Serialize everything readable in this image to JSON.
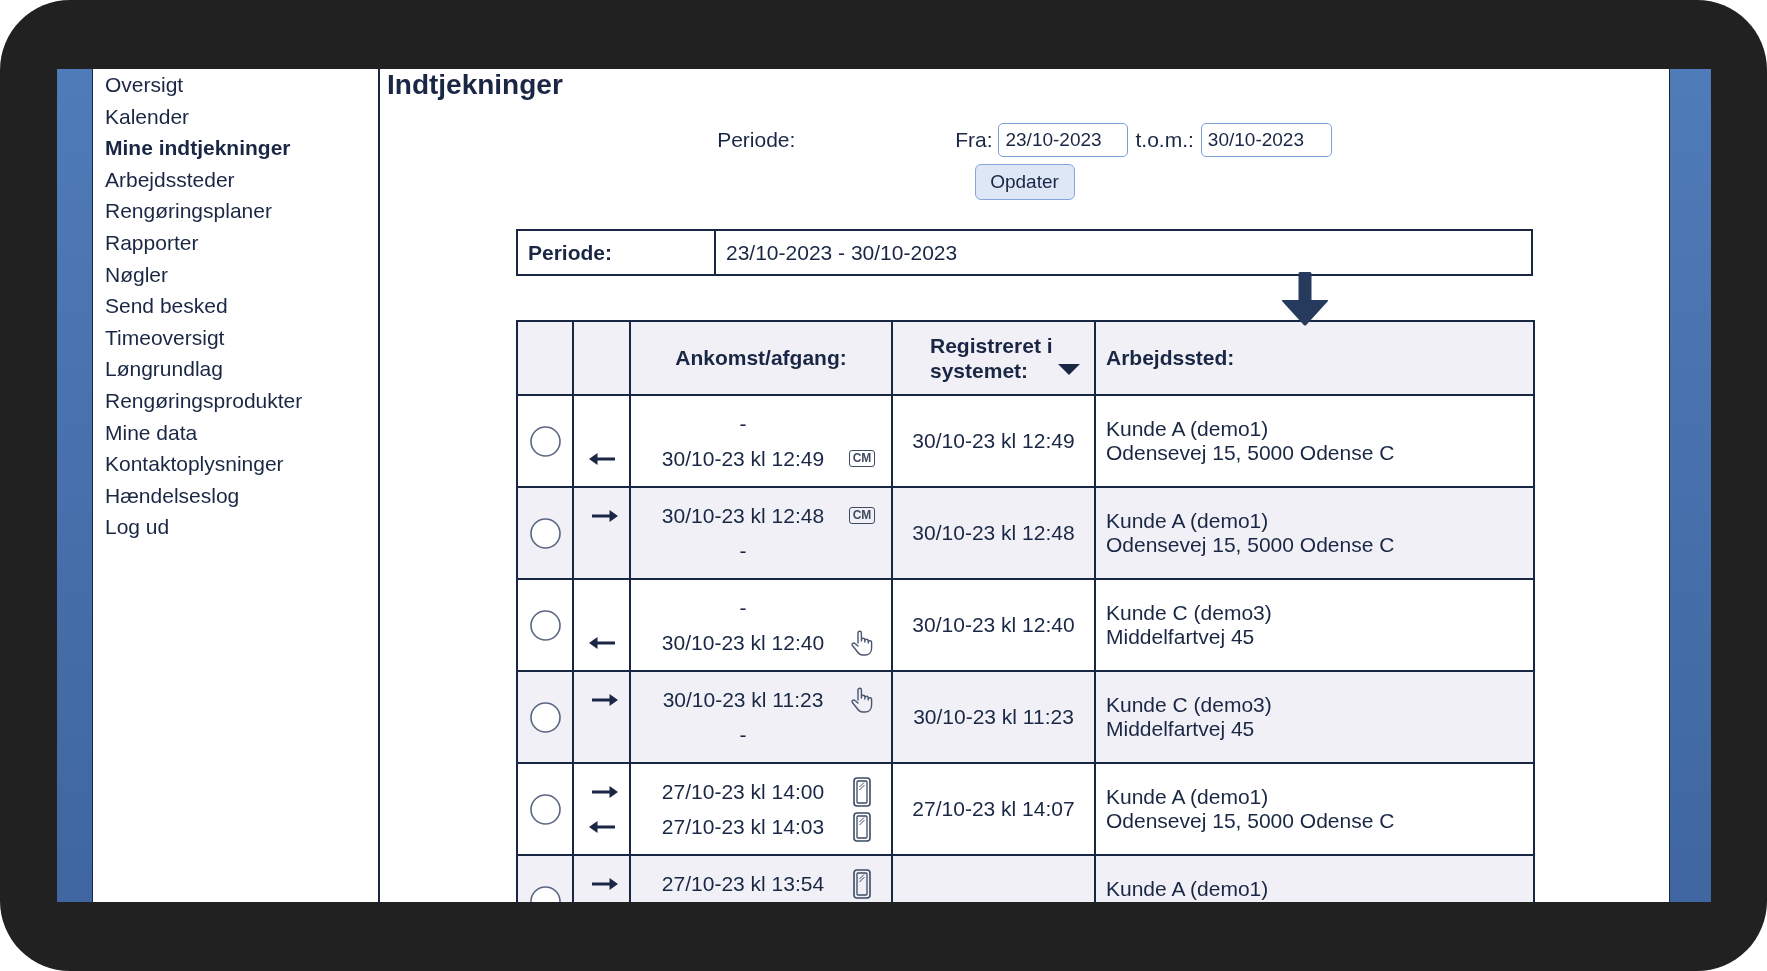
{
  "sidebar": {
    "items": [
      {
        "label": "Oversigt",
        "selected": false
      },
      {
        "label": "Kalender",
        "selected": false
      },
      {
        "label": "Mine indtjekninger",
        "selected": true
      },
      {
        "label": "Arbejdssteder",
        "selected": false
      },
      {
        "label": "Rengøringsplaner",
        "selected": false
      },
      {
        "label": "Rapporter",
        "selected": false
      },
      {
        "label": "Nøgler",
        "selected": false
      },
      {
        "label": "Send besked",
        "selected": false
      },
      {
        "label": "Timeoversigt",
        "selected": false
      },
      {
        "label": "Løngrundlag",
        "selected": false
      },
      {
        "label": "Rengøringsprodukter",
        "selected": false
      },
      {
        "label": "Mine data",
        "selected": false
      },
      {
        "label": "Kontaktoplysninger",
        "selected": false
      },
      {
        "label": "Hændelseslog",
        "selected": false
      },
      {
        "label": "Log ud",
        "selected": false
      }
    ]
  },
  "page": {
    "title": "Indtjekninger"
  },
  "filter": {
    "label": "Periode:",
    "from": {
      "label": "Fra:",
      "value": "23/10-2023"
    },
    "to": {
      "label": "t.o.m.:",
      "value": "30/10-2023"
    },
    "button": "Opdater"
  },
  "period_summary": {
    "label": "Periode:",
    "value": "23/10-2023 - 30/10-2023"
  },
  "table": {
    "columns": [
      {
        "label": "Ankomst/afgang:",
        "sorted": false
      },
      {
        "label": "Registreret i systemet:",
        "sorted": true
      },
      {
        "label": "Arbejdssted:",
        "sorted": false
      }
    ],
    "rows": [
      {
        "selected": false,
        "events": [
          {
            "kind": "missing",
            "time": "-"
          },
          {
            "kind": "departure",
            "time": "30/10-23 kl 12:49",
            "source": {
              "kind": "tag",
              "text": "CM"
            }
          }
        ],
        "registered": "30/10-23 kl 12:49",
        "workplace": {
          "name": "Kunde A (demo1)",
          "address": "Odensevej 15, 5000 Odense C"
        }
      },
      {
        "selected": false,
        "events": [
          {
            "kind": "arrival",
            "time": "30/10-23 kl 12:48",
            "source": {
              "kind": "tag",
              "text": "CM"
            }
          },
          {
            "kind": "missing",
            "time": "-"
          }
        ],
        "registered": "30/10-23 kl 12:48",
        "workplace": {
          "name": "Kunde A (demo1)",
          "address": "Odensevej 15, 5000 Odense C"
        }
      },
      {
        "selected": false,
        "events": [
          {
            "kind": "missing",
            "time": "-"
          },
          {
            "kind": "departure",
            "time": "30/10-23 kl 12:40",
            "source": {
              "kind": "hand"
            }
          }
        ],
        "registered": "30/10-23 kl 12:40",
        "workplace": {
          "name": "Kunde C (demo3)",
          "address": "Middelfartvej 45"
        }
      },
      {
        "selected": false,
        "events": [
          {
            "kind": "arrival",
            "time": "30/10-23 kl 11:23",
            "source": {
              "kind": "hand"
            }
          },
          {
            "kind": "missing",
            "time": "-"
          }
        ],
        "registered": "30/10-23 kl 11:23",
        "workplace": {
          "name": "Kunde C (demo3)",
          "address": "Middelfartvej 45"
        }
      },
      {
        "selected": false,
        "events": [
          {
            "kind": "arrival",
            "time": "27/10-23 kl 14:00",
            "source": {
              "kind": "phone"
            }
          },
          {
            "kind": "departure",
            "time": "27/10-23 kl 14:03",
            "source": {
              "kind": "phone"
            }
          }
        ],
        "registered": "27/10-23 kl 14:07",
        "workplace": {
          "name": "Kunde A (demo1)",
          "address": "Odensevej 15, 5000 Odense C"
        }
      },
      {
        "selected": false,
        "events": [
          {
            "kind": "arrival",
            "time": "27/10-23 kl 13:54",
            "source": {
              "kind": "phone"
            }
          }
        ],
        "workplace": {
          "name": "Kunde A (demo1)"
        }
      }
    ]
  }
}
